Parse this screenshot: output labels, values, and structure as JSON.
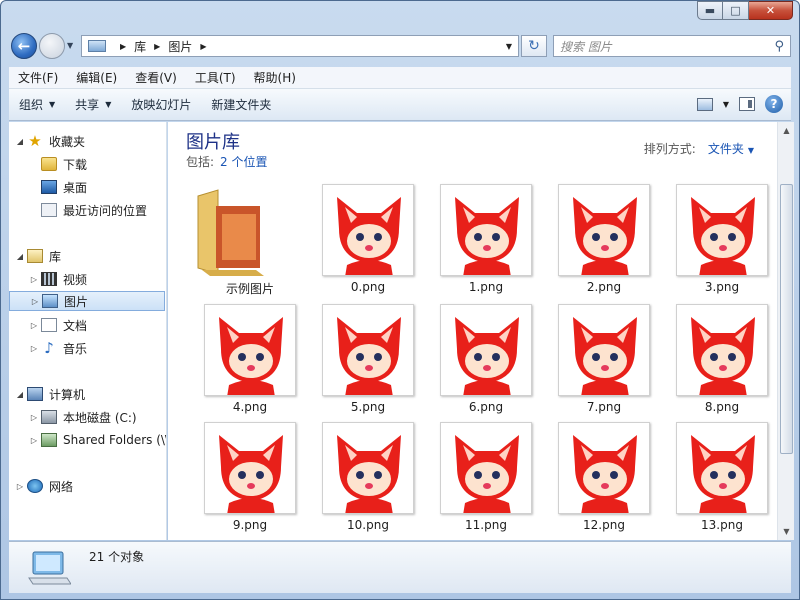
{
  "window": {
    "buttons": {
      "minimize": "▬",
      "maximize": "□",
      "close": "✕"
    }
  },
  "nav": {
    "breadcrumb": [
      "库",
      "图片"
    ],
    "search_placeholder": "搜索 图片",
    "back_icon": "←",
    "refresh_icon": "↻"
  },
  "menu": [
    "文件(F)",
    "编辑(E)",
    "查看(V)",
    "工具(T)",
    "帮助(H)"
  ],
  "toolbar": {
    "organize": "组织",
    "share": "共享",
    "slideshow": "放映幻灯片",
    "new_folder": "新建文件夹"
  },
  "sidebar": {
    "favorites": "收藏夹",
    "downloads": "下载",
    "desktop": "桌面",
    "recent": "最近访问的位置",
    "libraries": "库",
    "videos": "视频",
    "pictures": "图片",
    "documents": "文档",
    "music": "音乐",
    "computer": "计算机",
    "local_disk": "本地磁盘 (C:)",
    "shared_folders": "Shared Folders (\\\\",
    "network": "网络"
  },
  "content": {
    "title": "图片库",
    "includes_label": "包括:",
    "includes_link": "2 个位置",
    "arrange_label": "排列方式:",
    "arrange_value": "文件夹",
    "items": [
      "示例图片",
      "0.png",
      "1.png",
      "2.png",
      "3.png",
      "4.png",
      "5.png",
      "6.png",
      "7.png",
      "8.png",
      "9.png",
      "10.png",
      "11.png",
      "12.png",
      "13.png"
    ]
  },
  "status": {
    "count": "21 个对象"
  },
  "colors": {
    "accent": "#1e3287",
    "link": "#1a55b4",
    "fox_red": "#e8201a"
  }
}
